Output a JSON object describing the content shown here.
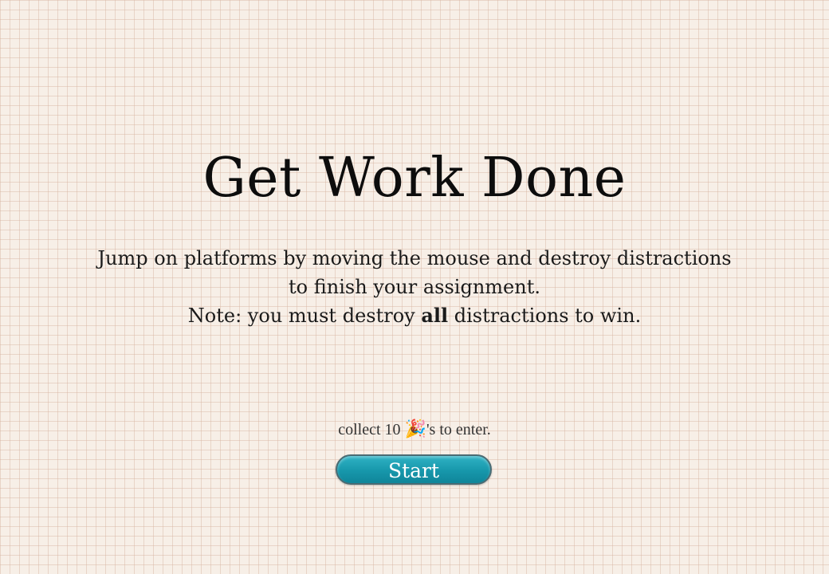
{
  "title": "Get Work Done",
  "instructions": {
    "line1": "Jump on platforms by moving the mouse and destroy distractions",
    "line2": "to finish your assignment.",
    "note_prefix": "Note: you must destroy ",
    "note_emphasis": "all",
    "note_suffix": " distractions to win."
  },
  "entry": {
    "prefix": "collect 10 ",
    "icon": "party-popper-icon",
    "icon_glyph": "🎉",
    "suffix": "'s to enter."
  },
  "start_button": {
    "label": "Start",
    "color": "#1797ab"
  }
}
